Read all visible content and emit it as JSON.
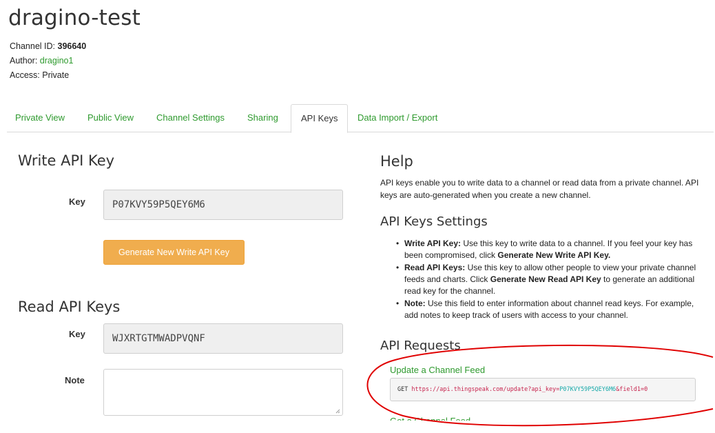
{
  "channel": {
    "title": "dragino-test",
    "id_label": "Channel ID:",
    "id_value": "396640",
    "author_label": "Author:",
    "author_value": "dragino1",
    "access_label": "Access:",
    "access_value": "Private"
  },
  "tabs": [
    {
      "label": "Private View",
      "active": false
    },
    {
      "label": "Public View",
      "active": false
    },
    {
      "label": "Channel Settings",
      "active": false
    },
    {
      "label": "Sharing",
      "active": false
    },
    {
      "label": "API Keys",
      "active": true
    },
    {
      "label": "Data Import / Export",
      "active": false
    }
  ],
  "write": {
    "heading": "Write API Key",
    "key_label": "Key",
    "key_value": "P07KVY59P5QEY6M6",
    "button_label": "Generate New Write API Key"
  },
  "read": {
    "heading": "Read API Keys",
    "key_label": "Key",
    "key_value": "WJXRTGTMWADPVQNF",
    "note_label": "Note",
    "note_value": ""
  },
  "help": {
    "heading": "Help",
    "intro_line1": "API keys enable you to write data to a channel or read data from a private channel. API",
    "intro_line2": "keys are auto-generated when you create a new channel.",
    "settings_heading": "API Keys Settings",
    "bullets": [
      {
        "title": "Write API Key:",
        "text1": " Use this key to write data to a channel. If you feel your key has been compromised, click ",
        "bold": "Generate New Write API Key.",
        "text2": ""
      },
      {
        "title": "Read API Keys:",
        "text1": " Use this key to allow other people to view your private channel feeds and charts. Click ",
        "bold": "Generate New Read API Key",
        "text2": " to generate an additional read key for the channel."
      },
      {
        "title": "Note:",
        "text1": " Use this field to enter information about channel read keys. For example, add notes to keep track of users with access to your channel.",
        "bold": "",
        "text2": ""
      }
    ],
    "requests_heading": "API Requests",
    "update_link": "Update a Channel Feed",
    "request_method": "GET",
    "request_url": "https://api.thingspeak.com/update?api_key=",
    "request_key": "P07KVY59P5QEY6M6",
    "request_tail": "&field1=0",
    "next_link": "Get a Channel Feed"
  },
  "colors": {
    "link": "#2e9a2e",
    "button": "#f0ad4e",
    "annotation": "#e00000"
  }
}
